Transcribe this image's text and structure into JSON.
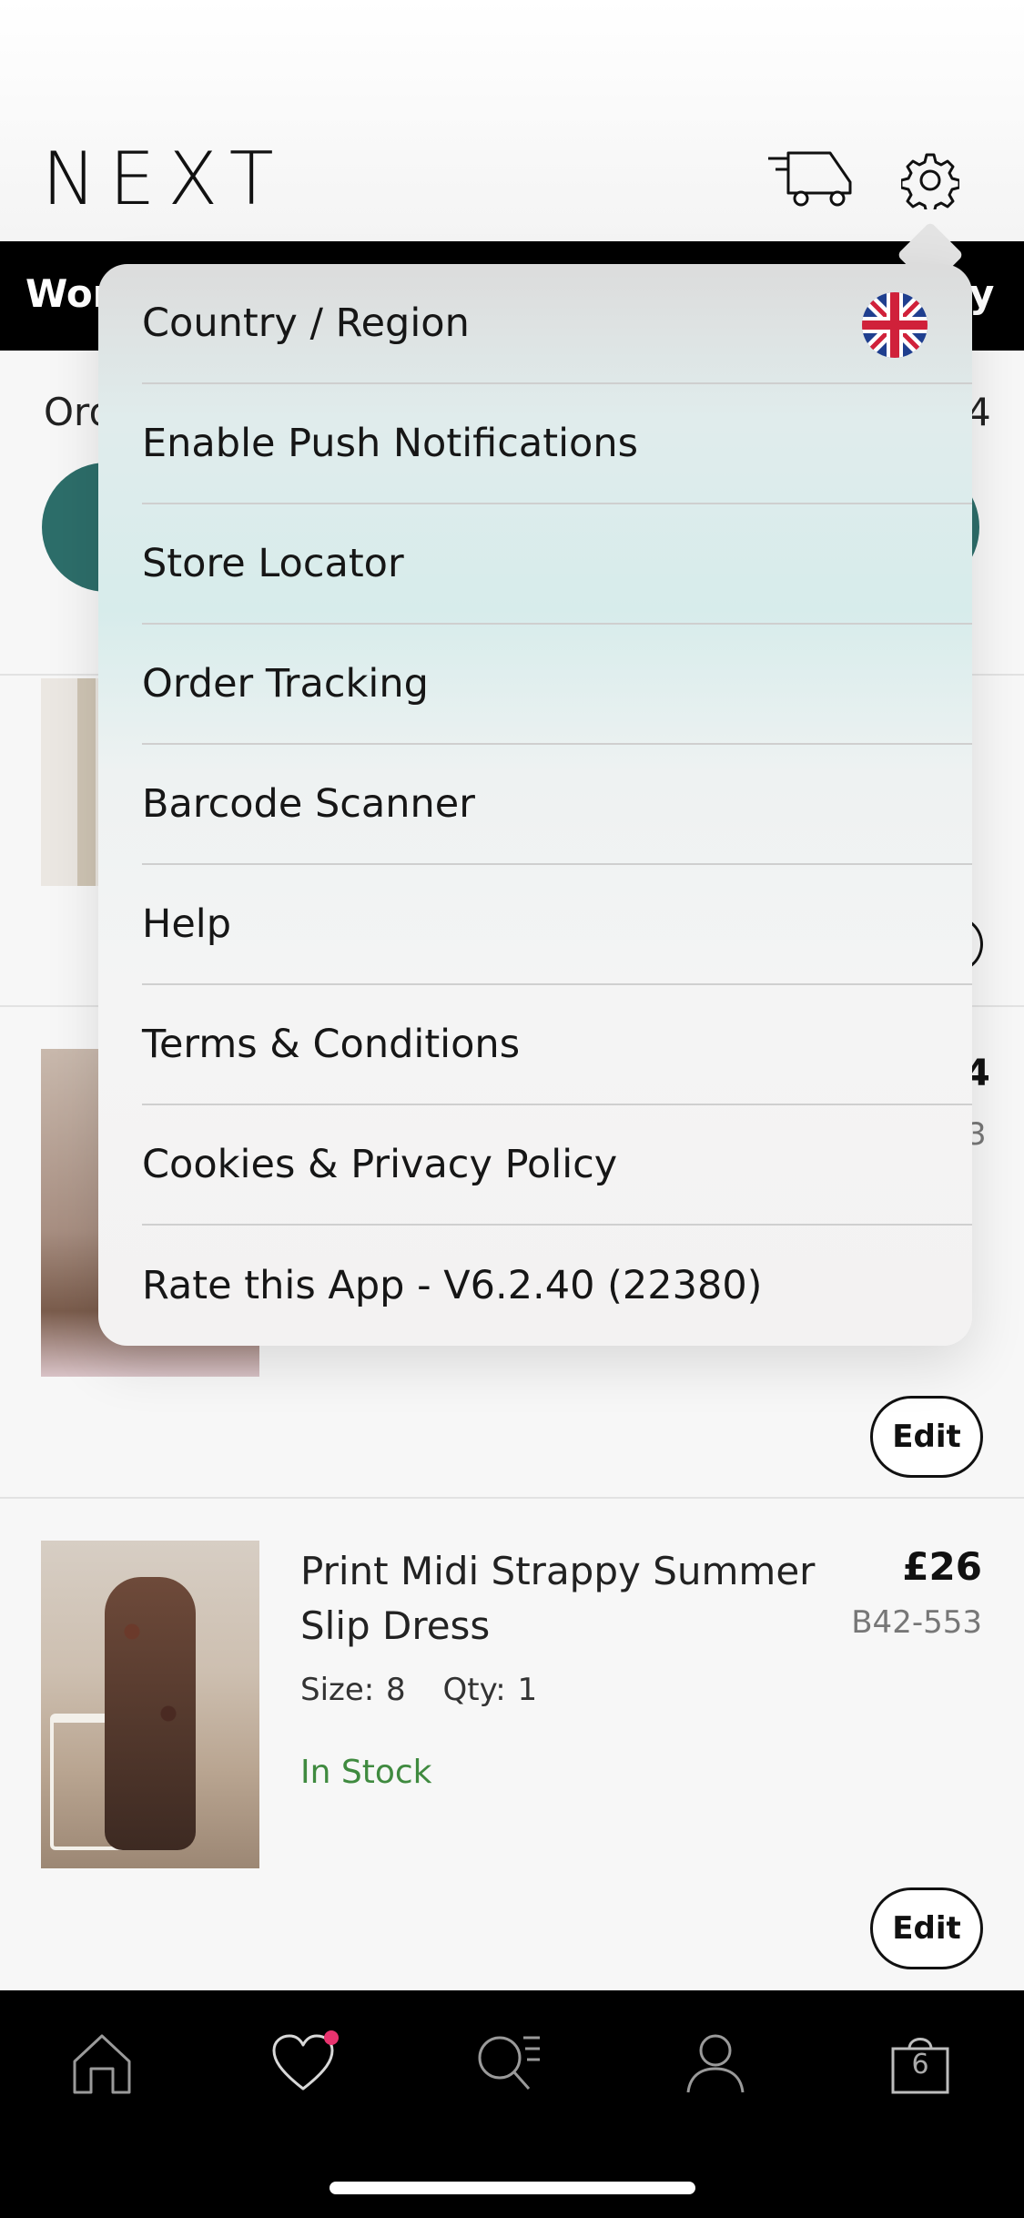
{
  "header": {
    "logo": "NEXT"
  },
  "category_bar": {
    "left_partial": "Wor",
    "right_partial": "y"
  },
  "order": {
    "label_partial": "Ord",
    "right_partial": "4"
  },
  "hidden_item": {
    "price_partial": "4",
    "code_partial": "3"
  },
  "settings_menu": {
    "items": [
      {
        "label": "Country / Region",
        "icon": "uk-flag-icon"
      },
      {
        "label": "Enable Push Notifications"
      },
      {
        "label": "Store Locator"
      },
      {
        "label": "Order Tracking"
      },
      {
        "label": "Barcode Scanner"
      },
      {
        "label": "Help"
      },
      {
        "label": "Terms & Conditions"
      },
      {
        "label": "Cookies & Privacy Policy"
      },
      {
        "label": "Rate this App - V6.2.40 (22380)"
      }
    ]
  },
  "items": [
    {
      "edit_label": "Edit"
    },
    {
      "name": "Print Midi Strappy Summer Slip Dress",
      "price": "£26",
      "code": "B42-553",
      "size": "Size: 8",
      "qty": "Qty: 1",
      "stock": "In Stock",
      "edit_label": "Edit"
    }
  ],
  "bottom_nav": {
    "items": [
      "home-icon",
      "heart-icon",
      "search-icon",
      "account-icon",
      "bag-icon"
    ],
    "bag_count": "6"
  },
  "colors": {
    "accent_teal": "#2d6e6a",
    "in_stock": "#3f8a3f",
    "favourite_dot": "#e8336e"
  }
}
